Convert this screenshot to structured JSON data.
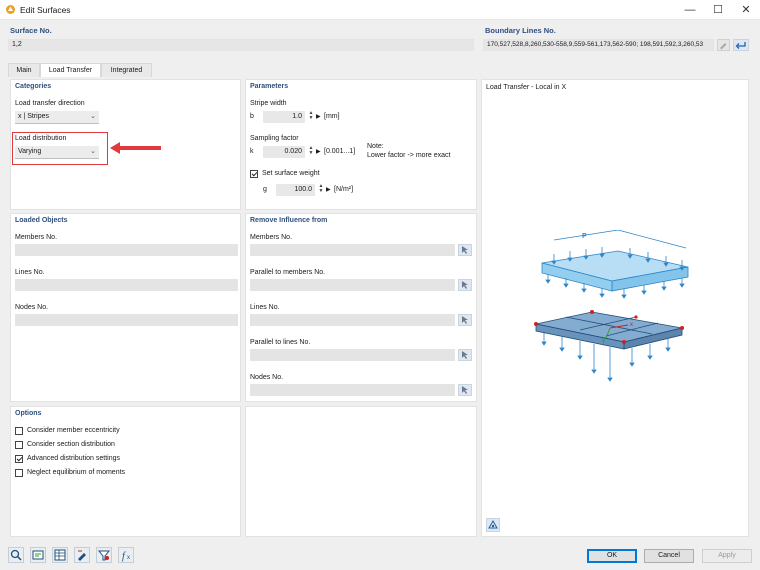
{
  "window": {
    "title": "Edit Surfaces",
    "controls": [
      "minimize-icon",
      "maximize-icon",
      "close-icon"
    ]
  },
  "header": {
    "surface_no_label": "Surface No.",
    "surface_no_value": "1,2",
    "boundary_label": "Boundary Lines No.",
    "boundary_value": "170,527,528,8,260,530-558,9,559-561,173,562-590; 198,591,592,3,260,53"
  },
  "tabs": [
    {
      "label": "Main",
      "active": false
    },
    {
      "label": "Load Transfer",
      "active": true
    },
    {
      "label": "Integrated",
      "active": false
    }
  ],
  "categories": {
    "title": "Categories",
    "direction_label": "Load transfer direction",
    "direction_value": "x | Stripes",
    "distribution_label": "Load distribution",
    "distribution_value": "Varying"
  },
  "parameters": {
    "title": "Parameters",
    "stripe_width_label": "Stripe width",
    "b_symbol": "b",
    "b_value": "1.0",
    "b_unit": "[mm]",
    "sampling_label": "Sampling factor",
    "k_symbol": "k",
    "k_value": "0.020",
    "k_range": "[0.001...1]",
    "note_title": "Note:",
    "note_text": "Lower factor -> more exact",
    "set_weight_label": "Set surface weight",
    "set_weight_checked": true,
    "g_symbol": "g",
    "g_value": "100.0",
    "g_unit": "[N/m²]"
  },
  "loaded_objects": {
    "title": "Loaded Objects",
    "members_label": "Members No.",
    "lines_label": "Lines No.",
    "nodes_label": "Nodes No."
  },
  "remove_influence": {
    "title": "Remove Influence from",
    "members_label": "Members No.",
    "parallel_members_label": "Parallel to members No.",
    "lines_label": "Lines No.",
    "parallel_lines_label": "Parallel to lines No.",
    "nodes_label": "Nodes No."
  },
  "options": {
    "title": "Options",
    "items": [
      {
        "label": "Consider member eccentricity",
        "checked": false
      },
      {
        "label": "Consider section distribution",
        "checked": false
      },
      {
        "label": "Advanced distribution settings",
        "checked": true
      },
      {
        "label": "Neglect equilibrium of moments",
        "checked": false
      }
    ]
  },
  "preview": {
    "title": "Load Transfer - Local in X",
    "load_label": "P",
    "axis_x": "x",
    "axis_y": "y"
  },
  "footer": {
    "ok": "OK",
    "cancel": "Cancel",
    "apply": "Apply",
    "tool_icons": [
      "search-icon",
      "units-icon",
      "table-icon",
      "edit-icon",
      "filter-icon",
      "formula-icon"
    ]
  },
  "colors": {
    "accent": "#0078d7",
    "highlight_red": "#e0393e",
    "label_blue": "#2f4f7f",
    "load_blue": "#3a9ad9"
  }
}
